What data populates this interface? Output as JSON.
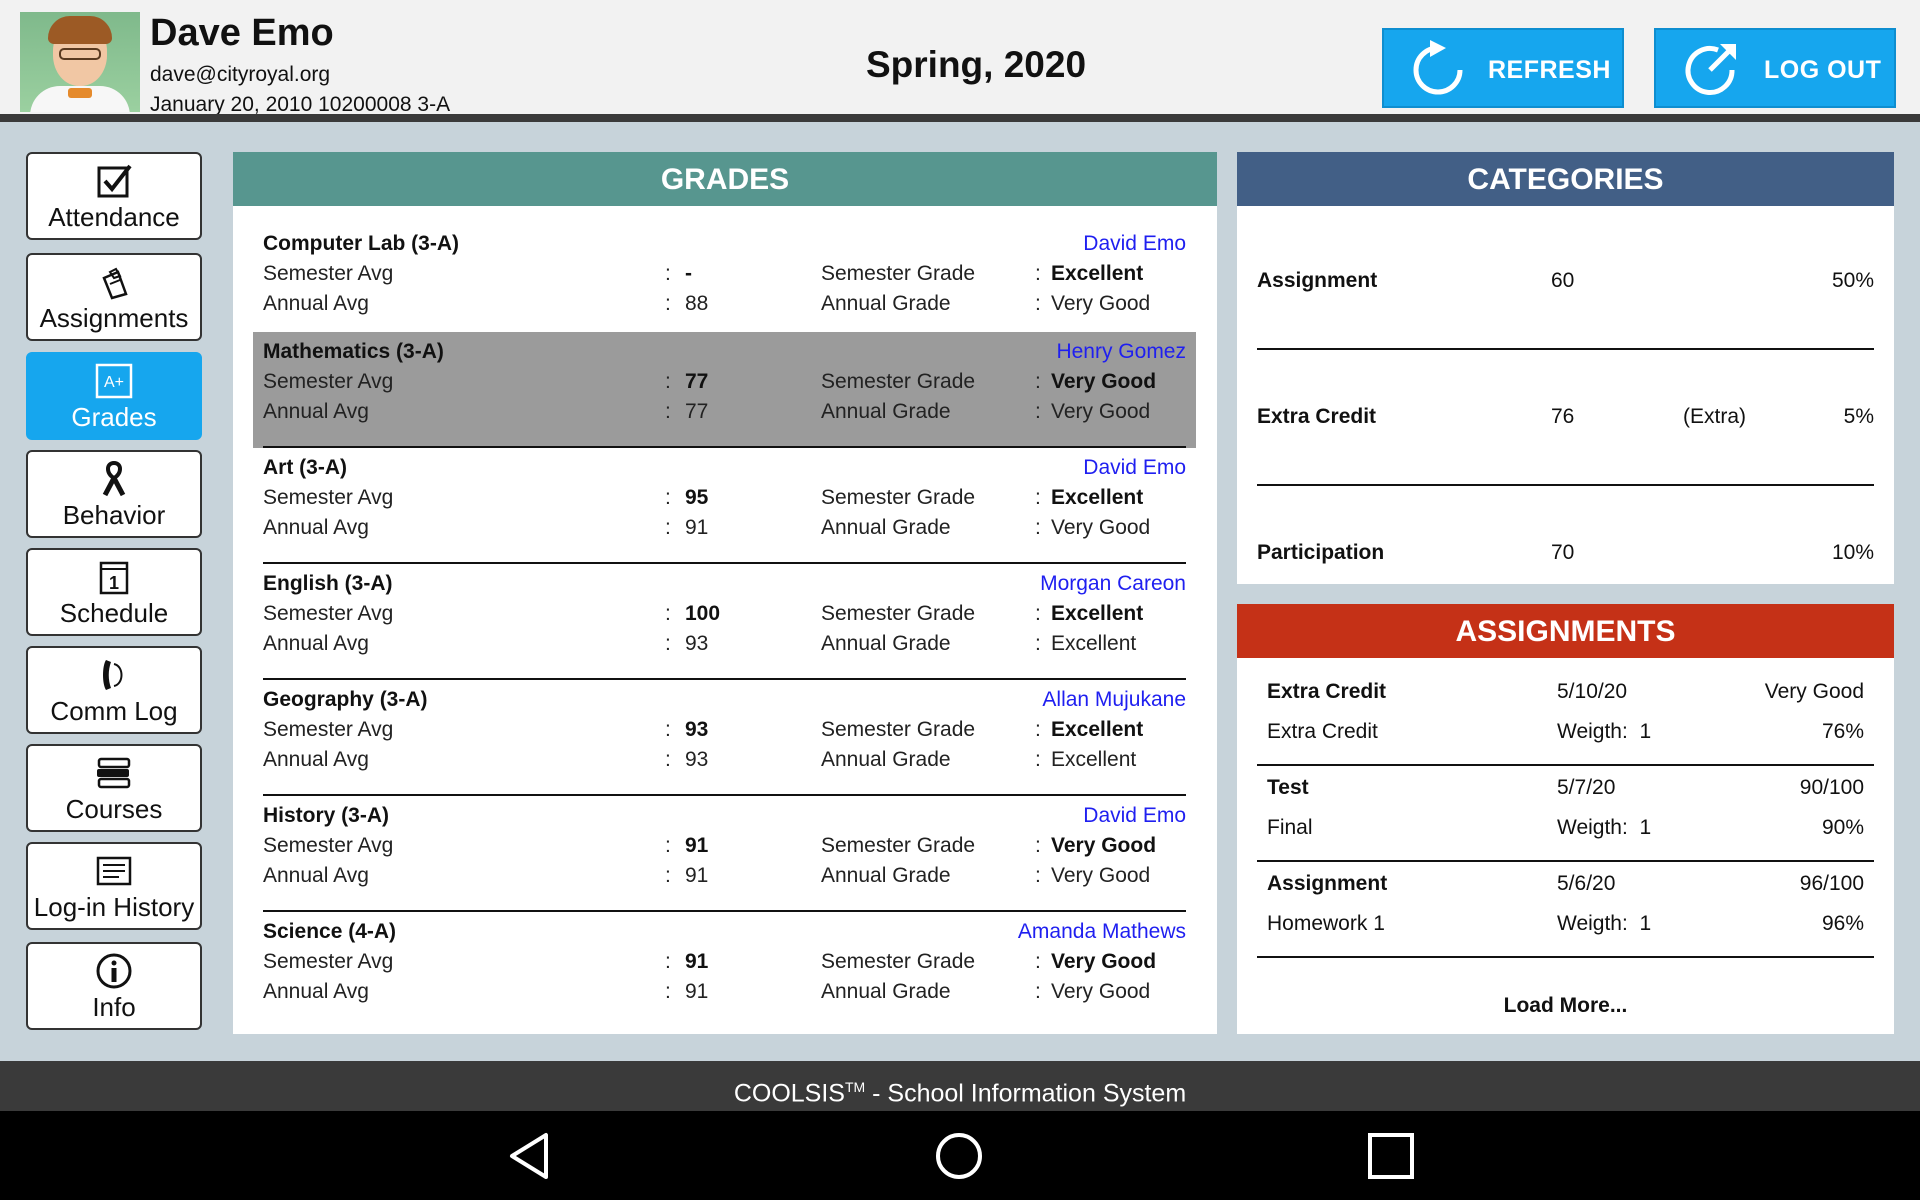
{
  "header": {
    "name": "Dave Emo",
    "email": "dave@cityroyal.org",
    "meta": "January 20, 2010 10200008 3-A",
    "term": "Spring, 2020",
    "refresh_label": "REFRESH",
    "logout_label": "LOG OUT"
  },
  "sidebar": {
    "items": [
      {
        "label": "Attendance",
        "icon": "checkbox-icon"
      },
      {
        "label": "Assignments",
        "icon": "clipboard-icon"
      },
      {
        "label": "Grades",
        "icon": "grade-icon"
      },
      {
        "label": "Behavior",
        "icon": "ribbon-icon"
      },
      {
        "label": "Schedule",
        "icon": "calendar-icon"
      },
      {
        "label": "Comm Log",
        "icon": "phone-icon"
      },
      {
        "label": "Courses",
        "icon": "books-icon"
      },
      {
        "label": "Log-in History",
        "icon": "history-icon"
      },
      {
        "label": "Info",
        "icon": "info-icon"
      }
    ],
    "active": "Grades"
  },
  "grades": {
    "title": "GRADES",
    "labels": {
      "sem_avg": "Semester Avg",
      "ann_avg": "Annual Avg",
      "sem_grade": "Semester Grade",
      "ann_grade": "Annual Grade",
      "colon": ":"
    },
    "courses": [
      {
        "name": "Computer Lab (3-A)",
        "teacher": "David Emo",
        "sem_avg": "-",
        "ann_avg": "88",
        "sem_grade": "Excellent",
        "ann_grade": "Very Good"
      },
      {
        "name": "Mathematics  (3-A)",
        "teacher": "Henry Gomez",
        "sem_avg": "77",
        "ann_avg": "77",
        "sem_grade": "Very Good",
        "ann_grade": "Very Good"
      },
      {
        "name": "Art (3-A)",
        "teacher": "David Emo",
        "sem_avg": "95",
        "ann_avg": "91",
        "sem_grade": "Excellent",
        "ann_grade": "Very Good"
      },
      {
        "name": "English (3-A)",
        "teacher": "Morgan Careon",
        "sem_avg": "100",
        "ann_avg": "93",
        "sem_grade": "Excellent",
        "ann_grade": "Excellent"
      },
      {
        "name": "Geography (3-A)",
        "teacher": "Allan Mujukane",
        "sem_avg": "93",
        "ann_avg": "93",
        "sem_grade": "Excellent",
        "ann_grade": "Excellent"
      },
      {
        "name": "History (3-A)",
        "teacher": "David Emo",
        "sem_avg": "91",
        "ann_avg": "91",
        "sem_grade": "Very Good",
        "ann_grade": "Very Good"
      },
      {
        "name": "Science (4-A)",
        "teacher": "Amanda Mathews",
        "sem_avg": "91",
        "ann_avg": "91",
        "sem_grade": "Very Good",
        "ann_grade": "Very Good"
      }
    ]
  },
  "categories": {
    "title": "CATEGORIES",
    "rows": [
      {
        "name": "Assignment",
        "value": "60",
        "extra": "",
        "percent": "50%"
      },
      {
        "name": "Extra Credit",
        "value": "76",
        "extra": "(Extra)",
        "percent": "5%"
      },
      {
        "name": "Participation",
        "value": "70",
        "extra": "",
        "percent": "10%"
      }
    ]
  },
  "assignments": {
    "title": "ASSIGNMENTS",
    "weight_label": "Weigth:",
    "items": [
      {
        "category": "Extra Credit",
        "date": "5/10/20",
        "result": "Very Good",
        "name": "Extra Credit",
        "weight": "1",
        "percent": "76%"
      },
      {
        "category": "Test",
        "date": "5/7/20",
        "result": "90/100",
        "name": "Final",
        "weight": "1",
        "percent": "90%"
      },
      {
        "category": "Assignment",
        "date": "5/6/20",
        "result": "96/100",
        "name": "Homework 1",
        "weight": "1",
        "percent": "96%"
      }
    ],
    "load_more": "Load More..."
  },
  "footer": {
    "brand": "COOLSIS",
    "tm": "TM",
    "tagline": " - School Information System"
  },
  "colors": {
    "accent": "#16a6ee",
    "grades_header": "#57968f",
    "categories_header": "#425f86",
    "assignments_header": "#c53117",
    "teacher_link": "#1f1ff0",
    "selected_row": "#9b9b9b"
  }
}
